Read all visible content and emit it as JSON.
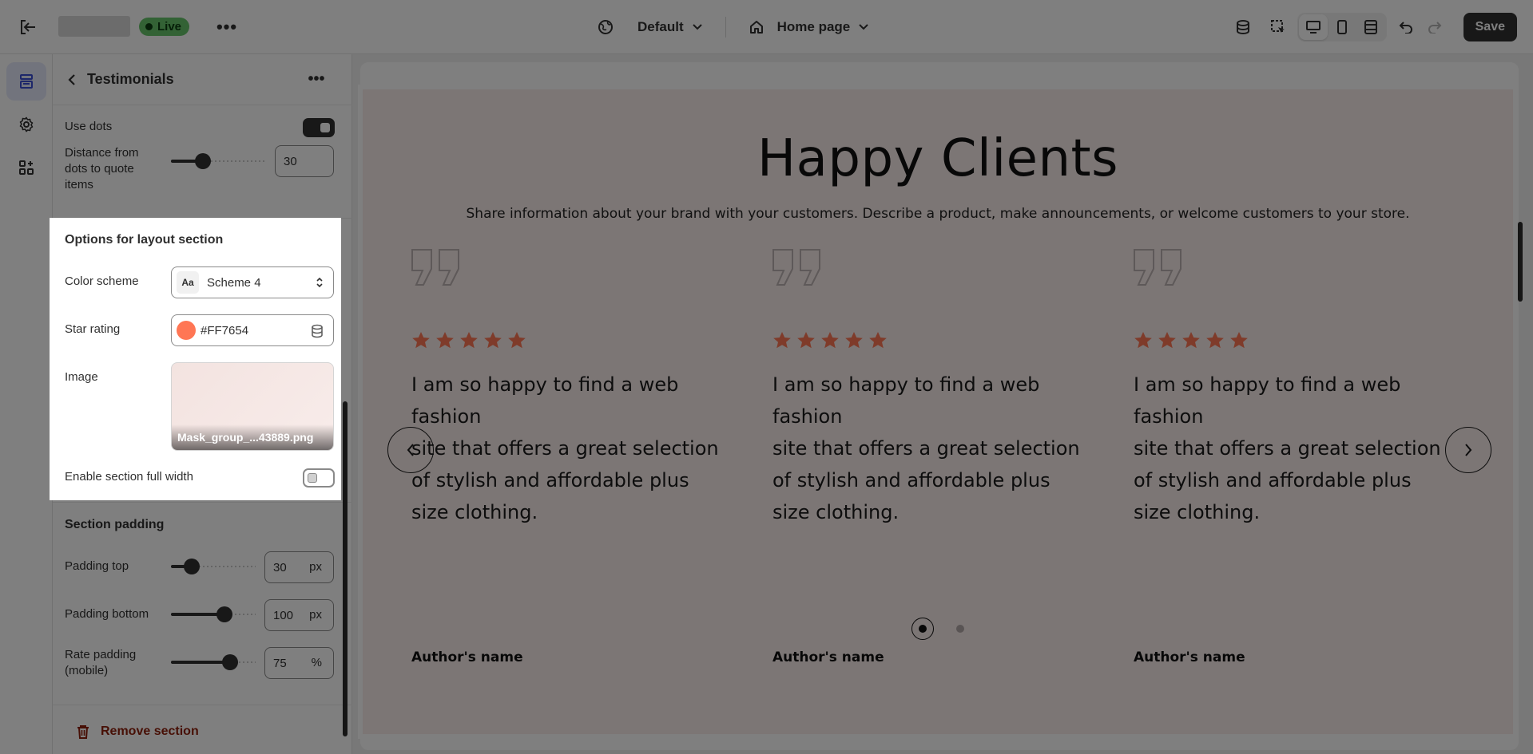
{
  "topbar": {
    "live_label": "Live",
    "more_glyph": "•••",
    "theme_label": "Default",
    "page_label": "Home page",
    "save_label": "Save"
  },
  "panel": {
    "title": "Testimonials",
    "more_glyph": "•••",
    "use_dots_label": "Use dots",
    "distance_label": "Distance from dots to quote items",
    "distance_value": "30",
    "layout_heading": "Options for layout section",
    "color_scheme_label": "Color scheme",
    "color_scheme_value": "Scheme 4",
    "star_rating_label": "Star rating",
    "star_rating_value": "#FF7654",
    "image_label": "Image",
    "image_filename": "Mask_group_...43889.png",
    "full_width_label": "Enable section full width",
    "padding_heading": "Section padding",
    "padding_top_label": "Padding top",
    "padding_top_value": "30",
    "padding_top_unit": "px",
    "padding_bottom_label": "Padding bottom",
    "padding_bottom_value": "100",
    "padding_bottom_unit": "px",
    "rate_padding_label": "Rate padding (mobile)",
    "rate_padding_value": "75",
    "rate_padding_unit": "%",
    "remove_label": "Remove section"
  },
  "preview": {
    "title": "Happy Clients",
    "subtitle": "Share information about your brand with your customers. Describe a product, make announcements, or welcome customers to your store.",
    "cards": [
      {
        "text": "I am so happy to find a web fashion\nsite that offers a great selection\nof stylish and affordable plus\nsize clothing.",
        "author": "Author's name"
      },
      {
        "text": "I am so happy to find a web fashion\nsite that offers a great selection\nof stylish and affordable plus\nsize clothing.",
        "author": "Author's name"
      },
      {
        "text": "I am so happy to find a web fashion\nsite that offers a great selection\nof stylish and affordable plus\nsize clothing.",
        "author": "Author's name"
      }
    ]
  },
  "colors": {
    "star": "#FF7654",
    "live_badge": "#67C46A",
    "section_bg": "#F8ECEB",
    "accent": "#303030"
  }
}
